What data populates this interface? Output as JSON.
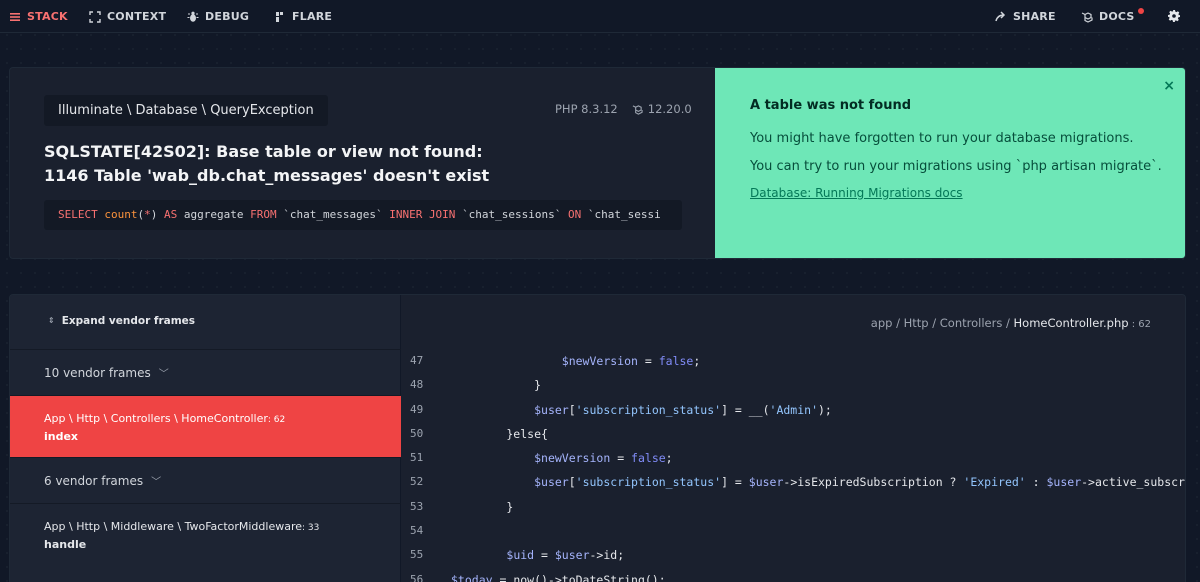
{
  "nav": {
    "stack": "STACK",
    "context": "CONTEXT",
    "debug": "DEBUG",
    "flare": "FLARE",
    "share": "SHARE",
    "docs": "DOCS"
  },
  "exception": {
    "class": "Illuminate \\ Database \\ QueryException",
    "php_version": "PHP 8.3.12",
    "laravel_version": "12.20.0",
    "message": "SQLSTATE[42S02]: Base table or view not found: 1146 Table 'wab_db.chat_messages' doesn't exist",
    "sql": {
      "kw_select": "SELECT",
      "fn_count": "count",
      "paren_open": "(",
      "star": "*",
      "paren_close": ")",
      "kw_as": "AS",
      "ident_aggregate": "aggregate",
      "kw_from": "FROM",
      "tbl_messages": "`chat_messages`",
      "kw_inner_join": "INNER JOIN",
      "tbl_sessions": "`chat_sessions`",
      "kw_on": "ON",
      "tbl_partial": "`chat_sessi"
    }
  },
  "solution": {
    "title": "A table was not found",
    "line1": "You might have forgotten to run your database migrations.",
    "line2": "You can try to run your migrations using `php artisan migrate`.",
    "link": "Database: Running Migrations docs",
    "close": "×"
  },
  "frames": {
    "expand_label": "Expand vendor frames",
    "items": [
      {
        "type": "vendor",
        "label": "10 vendor frames"
      },
      {
        "type": "app",
        "path": "App \\ Http \\ Controllers \\ HomeController",
        "line": ": 62",
        "method": "index"
      },
      {
        "type": "vendor",
        "label": "6 vendor frames"
      },
      {
        "type": "app",
        "path": "App \\ Http \\ Middleware \\ TwoFactorMiddleware",
        "line": ": 33",
        "method": "handle"
      }
    ]
  },
  "code": {
    "file_dir": "app / Http / Controllers / ",
    "file_name": "HomeController.php",
    "file_line": " : 62",
    "lines": [
      {
        "n": "47",
        "indent": "                ",
        "var": "$newVersion",
        "rest": " = ",
        "bool": "false",
        "end": ";"
      },
      {
        "n": "48",
        "text": "            }"
      },
      {
        "n": "49",
        "indent": "            ",
        "var": "$user",
        "rest": "[",
        "str": "'subscription_status'",
        "rest2": "] = __(",
        "str2": "'Admin'",
        "end": ");"
      },
      {
        "n": "50",
        "text": "        }else{"
      },
      {
        "n": "51",
        "indent": "            ",
        "var": "$newVersion",
        "rest": " = ",
        "bool": "false",
        "end": ";"
      },
      {
        "n": "52",
        "indent": "            ",
        "var": "$user",
        "rest": "[",
        "str": "'subscription_status'",
        "rest2": "] = ",
        "var2": "$user",
        "rest3": "->isExpiredSubscription ? ",
        "str2": "'Expired'",
        "rest4": " : ",
        "var3": "$user",
        "end": "->active_subscrip"
      },
      {
        "n": "53",
        "text": "        }"
      },
      {
        "n": "54",
        "text": ""
      },
      {
        "n": "55",
        "indent": "        ",
        "var": "$uid",
        "rest": " = ",
        "var2": "$user",
        "end": "->id;"
      },
      {
        "n": "56",
        "indent": "",
        "var": "$today",
        "rest": " = now()->toDateString();"
      }
    ]
  },
  "colors": {
    "accent_red": "#ef4444",
    "solution_green": "#6ee7b7",
    "background": "#111827"
  }
}
